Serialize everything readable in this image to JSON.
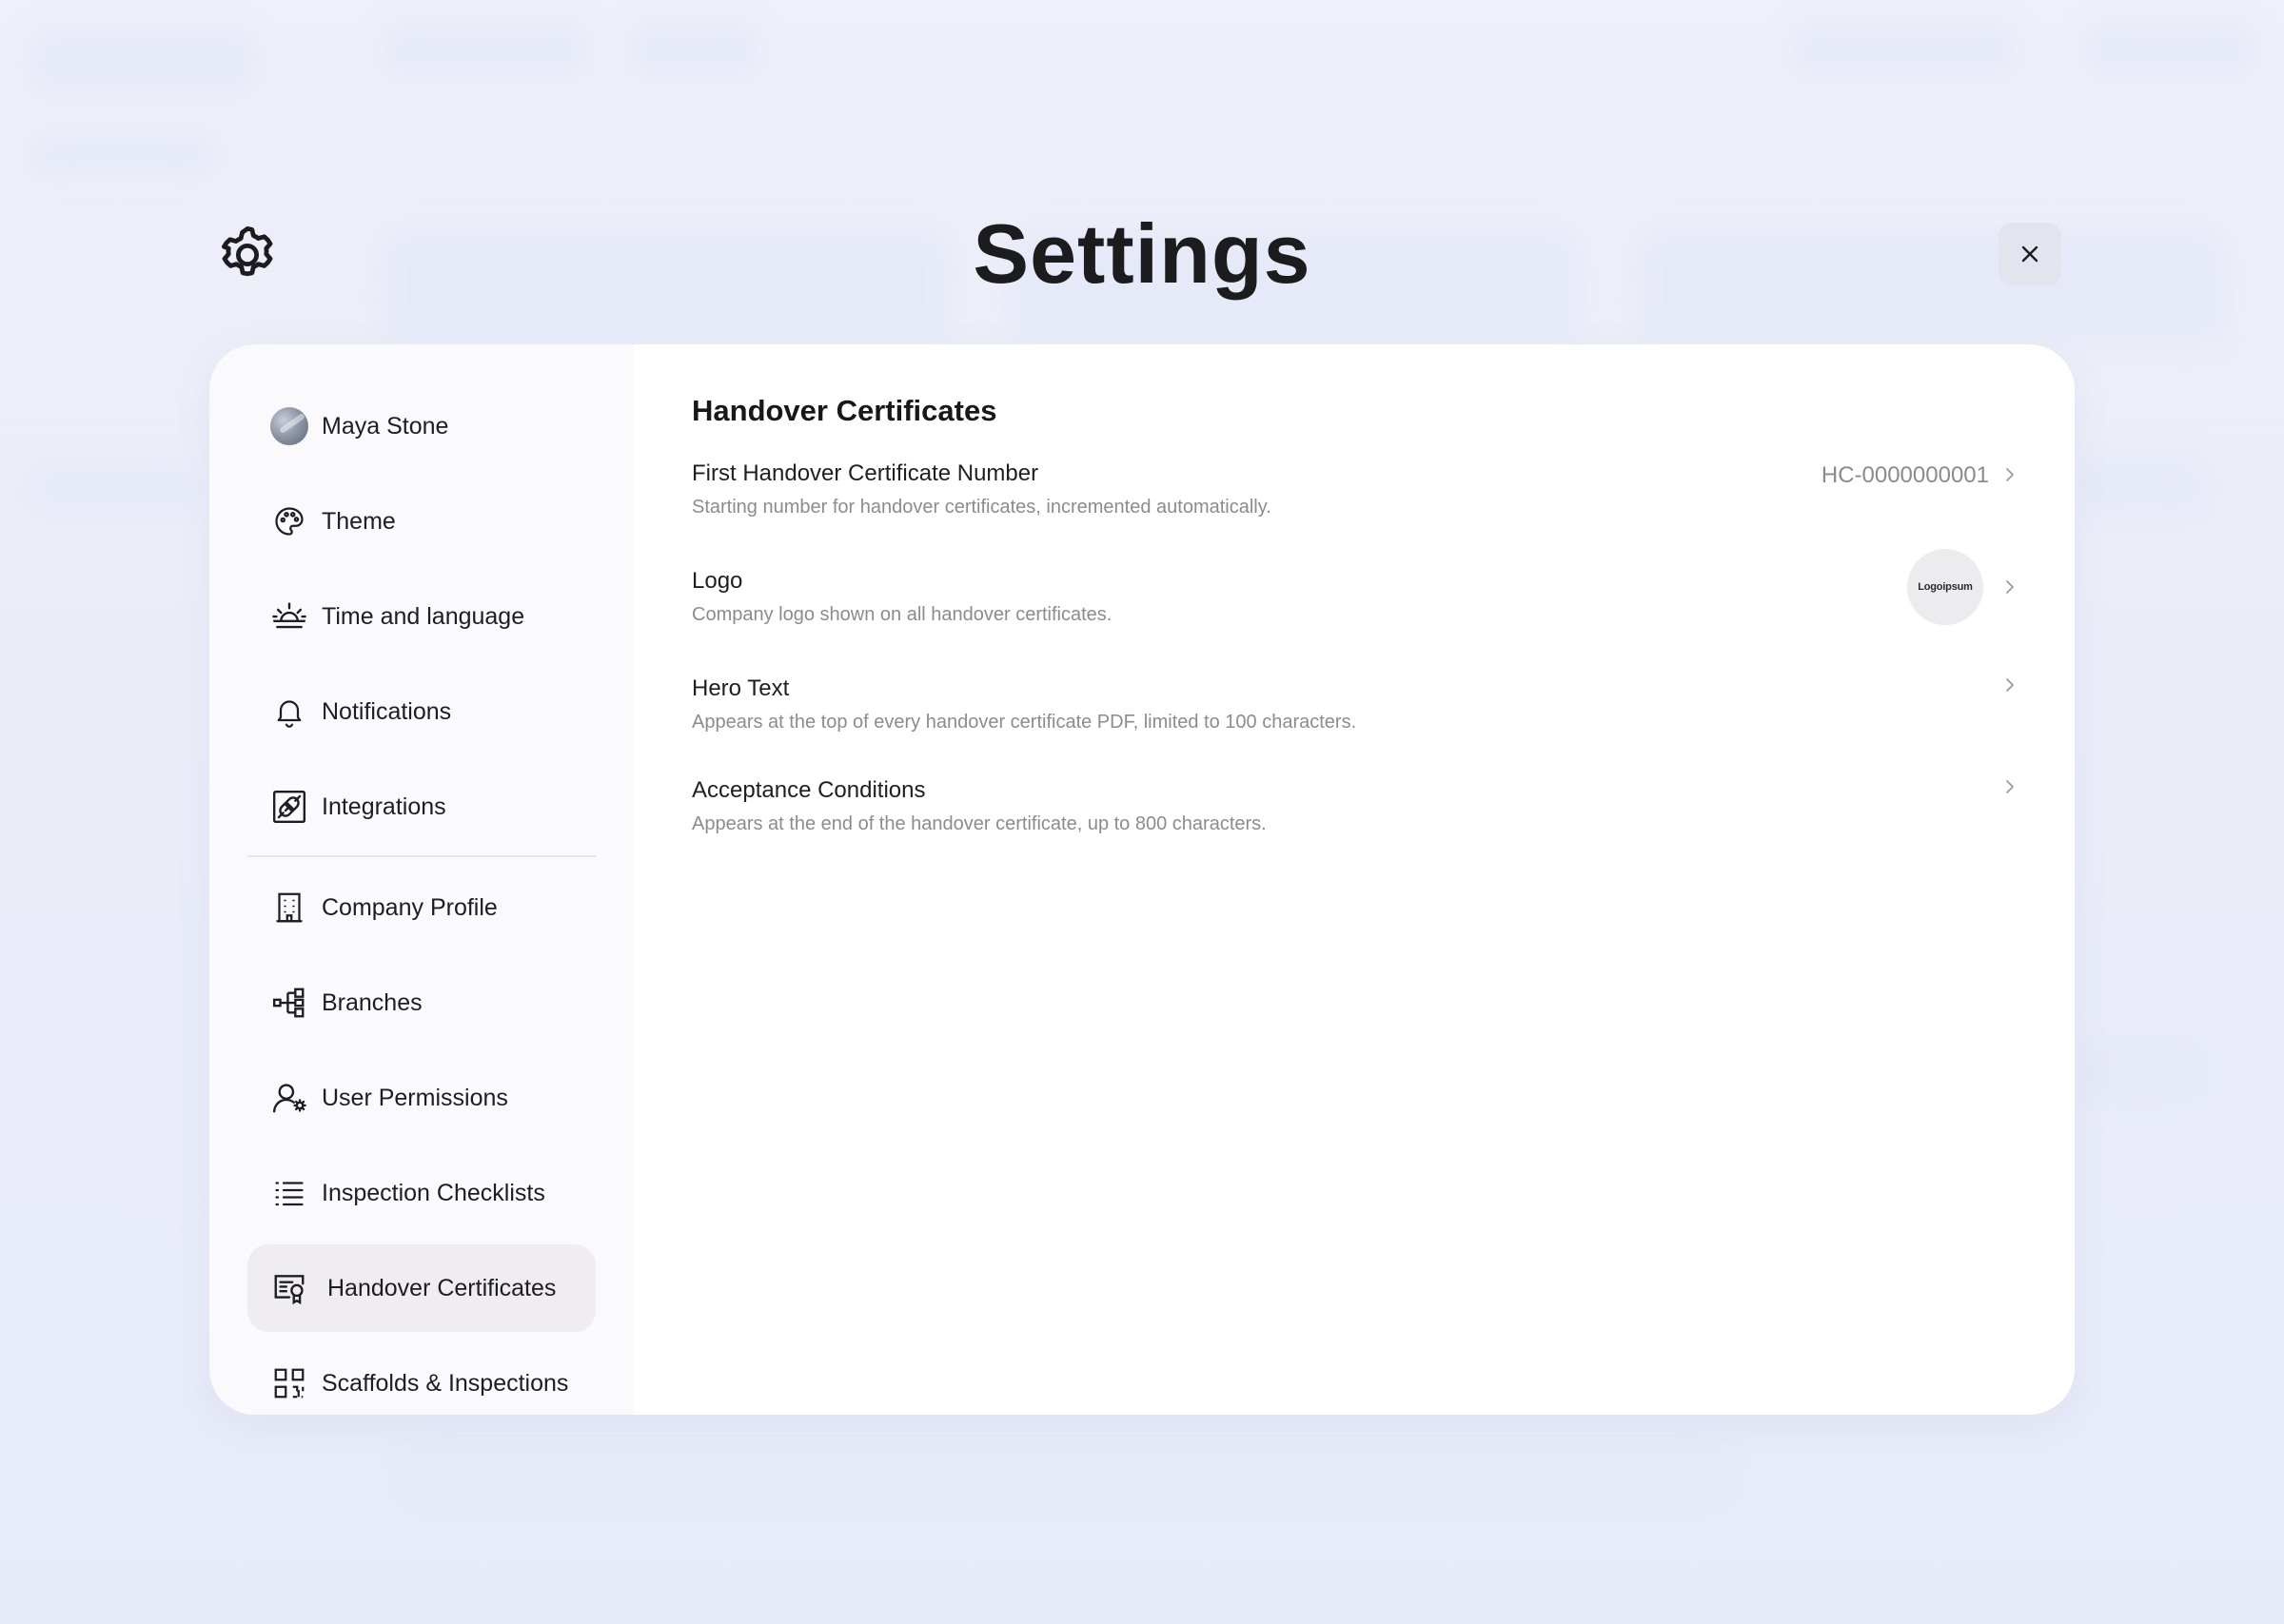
{
  "window": {
    "title": "Settings"
  },
  "sidebar": {
    "profile": {
      "name": "Maya Stone"
    },
    "items": [
      {
        "label": "Theme",
        "icon": "palette-icon"
      },
      {
        "label": "Time and language",
        "icon": "sunrise-icon"
      },
      {
        "label": "Notifications",
        "icon": "bell-icon"
      },
      {
        "label": "Integrations",
        "icon": "plug-icon"
      },
      {
        "label": "Company Profile",
        "icon": "building-icon"
      },
      {
        "label": "Branches",
        "icon": "branches-icon"
      },
      {
        "label": "User Permissions",
        "icon": "user-gear-icon"
      },
      {
        "label": "Inspection Checklists",
        "icon": "list-icon"
      },
      {
        "label": "Handover Certificates",
        "icon": "certificate-icon",
        "active": true
      },
      {
        "label": "Scaffolds & Inspections",
        "icon": "qr-code-icon"
      }
    ]
  },
  "main": {
    "section_title": "Handover Certificates",
    "rows": [
      {
        "title": "First Handover Certificate Number",
        "description": "Starting number for handover certificates, incremented automatically.",
        "value": "HC-0000000001"
      },
      {
        "title": "Logo",
        "description": "Company logo shown on all handover certificates.",
        "logo_text": "Logoipsum"
      },
      {
        "title": "Hero Text",
        "description": "Appears at the top of every handover certificate PDF, limited to 100 characters."
      },
      {
        "title": "Acceptance Conditions",
        "description": "Appears at the end of the handover certificate, up to 800 characters."
      }
    ]
  },
  "colors": {
    "accent_active": "#efedf2",
    "panel_bg": "#ffffff",
    "muted_text": "#8b8b92"
  }
}
